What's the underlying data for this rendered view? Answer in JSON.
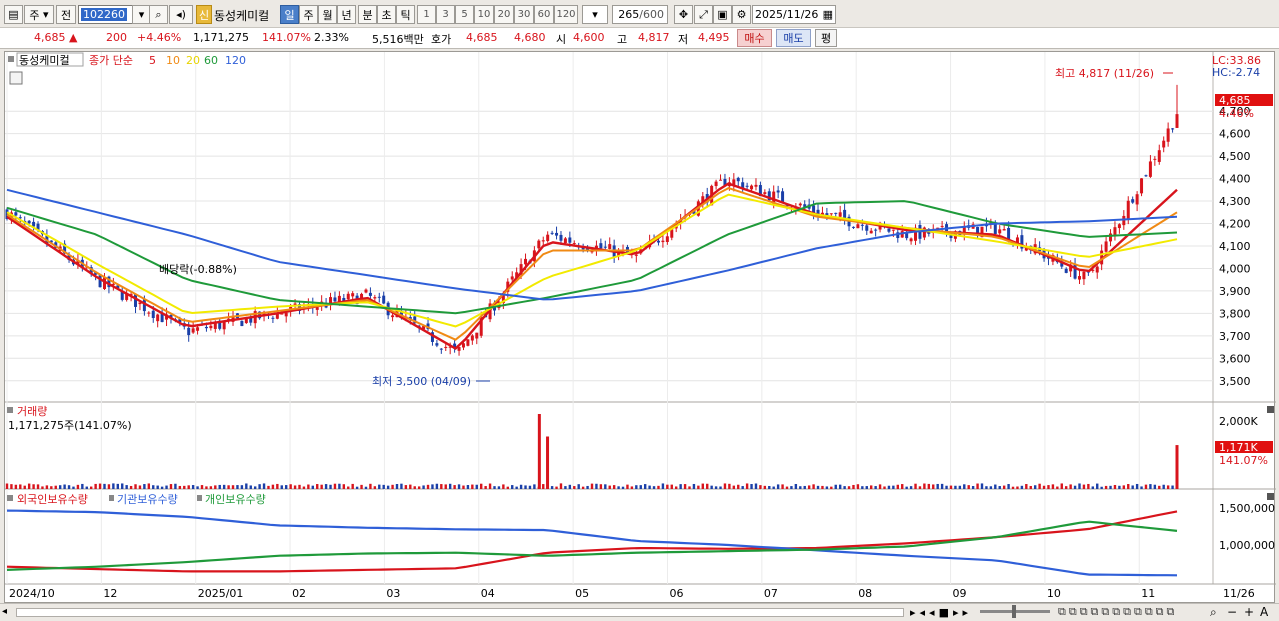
{
  "toolbar": {
    "market_label": "주",
    "prev_label": "전",
    "stock_code": "102260",
    "badge_new": "신",
    "stock_name": "동성케미컬",
    "period_day": "일",
    "period_week": "주",
    "period_month": "월",
    "period_year": "년",
    "period_minute": "분",
    "period_second": "초",
    "period_tick": "틱",
    "intervals": [
      "1",
      "3",
      "5",
      "10",
      "20",
      "30",
      "60",
      "120"
    ],
    "count_value": "265",
    "count_max": "/600",
    "date_value": "2025/11/26"
  },
  "quote": {
    "price": "4,685",
    "arrow": "▲",
    "change": "200",
    "change_pct": "+4.46%",
    "volume": "1,171,275",
    "volume_ratio": "141.07%",
    "turnover": "2.33%",
    "amount": "5,516백만",
    "ask_label": "호가",
    "ask1": "4,685",
    "ask2": "4,680",
    "open_label": "시",
    "open": "4,600",
    "high_label": "고",
    "high": "4,817",
    "low_label": "저",
    "low": "4,495",
    "buy_label": "매수",
    "sell_label": "매도",
    "eval_label": "평"
  },
  "legend": {
    "stock_name": "동성케미컬",
    "price_label": "종가 단순",
    "ma_periods": [
      "5",
      "10",
      "20",
      "60",
      "120"
    ]
  },
  "colors": {
    "up": "#d8141c",
    "down": "#1a3fa8",
    "ma5": "#d8141c",
    "ma10": "#f08a14",
    "ma20": "#f2ea00",
    "ma60": "#1f9a3a",
    "ma120": "#2f5fd8"
  },
  "annotations": {
    "high_note": "최고 4,817 (11/26)",
    "low_note": "최저 3,500 (04/09)",
    "dividend_note": "배당락(-0.88%)"
  },
  "price_axis": {
    "lc": "LC:33.86",
    "hc": "HC:-2.74",
    "current_box": "4,685",
    "current_pct": "4.46%",
    "ticks": [
      "4,700",
      "4,600",
      "4,500",
      "4,400",
      "4,300",
      "4,200",
      "4,100",
      "4,000",
      "3,900",
      "3,800",
      "3,700",
      "3,600",
      "3,500"
    ]
  },
  "volume_panel": {
    "title": "거래량",
    "value": "1,171,275주(141.07%)",
    "axis_max": "2,000K",
    "current_box": "1,171K",
    "current_pct": "141.07%"
  },
  "holdings_panel": {
    "series": [
      "외국인보유수량",
      "기관보유수량",
      "개인보유수량"
    ],
    "ticks": [
      "1,500,000",
      "1,000,000"
    ]
  },
  "x_axis": {
    "labels": [
      "2024/10",
      "12",
      "2025/01",
      "02",
      "03",
      "04",
      "05",
      "06",
      "07",
      "08",
      "09",
      "10",
      "11"
    ],
    "end_label": "11/26"
  },
  "chart_data": [
    {
      "type": "candlestick",
      "title": "동성케미컬",
      "ylabel": "",
      "ylim": [
        3450,
        4830
      ],
      "x": [
        "2024/10",
        "12",
        "2025/01",
        "02",
        "03",
        "04",
        "05",
        "06",
        "07",
        "08",
        "09",
        "10",
        "11",
        "11/26"
      ],
      "series": [
        {
          "name": "종가",
          "values": [
            4250,
            3950,
            3720,
            3800,
            3880,
            3620,
            4150,
            4050,
            4400,
            4250,
            4150,
            4180,
            3950,
            4685
          ]
        },
        {
          "name": "5",
          "values": [
            4230,
            3960,
            3740,
            3800,
            3870,
            3640,
            4120,
            4060,
            4380,
            4240,
            4170,
            4150,
            3980,
            4350
          ]
        },
        {
          "name": "10",
          "values": [
            4240,
            3980,
            3760,
            3810,
            3860,
            3680,
            4080,
            4080,
            4360,
            4230,
            4180,
            4140,
            4000,
            4250
          ]
        },
        {
          "name": "20",
          "values": [
            4250,
            4020,
            3800,
            3830,
            3850,
            3740,
            3960,
            4080,
            4330,
            4240,
            4180,
            4120,
            4050,
            4130
          ]
        },
        {
          "name": "60",
          "values": [
            4270,
            4150,
            3950,
            3860,
            3830,
            3800,
            3870,
            3950,
            4150,
            4290,
            4300,
            4200,
            4140,
            4160
          ]
        },
        {
          "name": "120",
          "values": [
            4350,
            4250,
            4150,
            4030,
            3970,
            3910,
            3860,
            3900,
            3990,
            4090,
            4160,
            4200,
            4210,
            4230
          ]
        }
      ],
      "high": {
        "value": 4817,
        "date": "11/26"
      },
      "low": {
        "value": 3500,
        "date": "04/09"
      }
    },
    {
      "type": "bar",
      "title": "거래량",
      "ylim": [
        0,
        2000000
      ],
      "spikes": [
        {
          "x": "04",
          "value": 2000000
        },
        {
          "x": "04",
          "value": 1400000
        },
        {
          "x": "11/26",
          "value": 1171275
        }
      ]
    },
    {
      "type": "line",
      "title": "외국인보유수량 · 기관보유수량 · 개인보유수량",
      "x": [
        "2024/10",
        "12",
        "2025/01",
        "02",
        "03",
        "04",
        "05",
        "06",
        "07",
        "08",
        "09",
        "10",
        "11",
        "11/26"
      ],
      "series": [
        {
          "name": "외국인보유수량",
          "values": [
            820000,
            790000,
            760000,
            760000,
            780000,
            800000,
            1000000,
            1060000,
            1050000,
            1060000,
            1120000,
            1200000,
            1300000,
            1530000
          ]
        },
        {
          "name": "기관보유수량",
          "values": [
            1540000,
            1520000,
            1460000,
            1350000,
            1320000,
            1300000,
            1290000,
            1150000,
            1100000,
            1030000,
            960000,
            900000,
            720000,
            710000
          ]
        },
        {
          "name": "개인보유수량",
          "values": [
            780000,
            820000,
            880000,
            960000,
            990000,
            1000000,
            960000,
            1000000,
            1020000,
            1040000,
            1080000,
            1200000,
            1400000,
            1280000
          ]
        }
      ]
    }
  ]
}
